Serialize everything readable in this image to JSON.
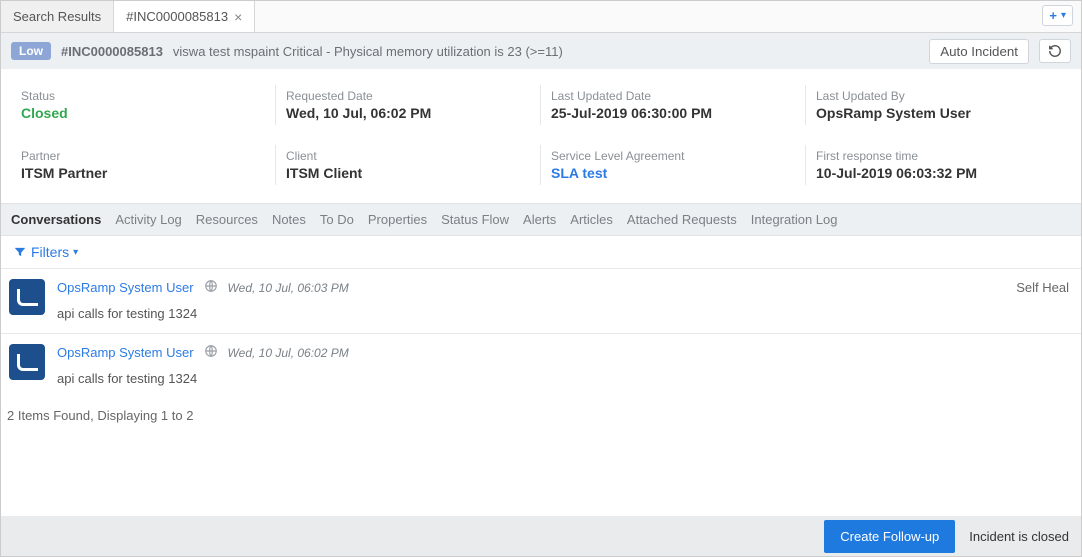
{
  "tabs": {
    "searchResults": "Search Results",
    "active": "#INC0000085813"
  },
  "header": {
    "priority": "Low",
    "id": "#INC0000085813",
    "title": "viswa test mspaint Critical - Physical memory utilization is 23 (>=11)",
    "autoIncident": "Auto Incident"
  },
  "details": {
    "statusLabel": "Status",
    "statusValue": "Closed",
    "requestedLabel": "Requested Date",
    "requestedValue": "Wed, 10 Jul, 06:02 PM",
    "updatedLabel": "Last Updated Date",
    "updatedValue": "25-Jul-2019 06:30:00 PM",
    "updatedByLabel": "Last Updated By",
    "updatedByValue": "OpsRamp System User",
    "partnerLabel": "Partner",
    "partnerValue": "ITSM Partner",
    "clientLabel": "Client",
    "clientValue": "ITSM Client",
    "slaLabel": "Service Level Agreement",
    "slaValue": "SLA test",
    "firstRespLabel": "First response time",
    "firstRespValue": "10-Jul-2019 06:03:32 PM"
  },
  "subtabs": {
    "conversations": "Conversations",
    "activityLog": "Activity Log",
    "resources": "Resources",
    "notes": "Notes",
    "todo": "To Do",
    "properties": "Properties",
    "statusFlow": "Status Flow",
    "alerts": "Alerts",
    "articles": "Articles",
    "attached": "Attached Requests",
    "integration": "Integration Log"
  },
  "filtersLabel": "Filters",
  "conversations": [
    {
      "user": "OpsRamp System User",
      "time": "Wed, 10 Jul, 06:03 PM",
      "tag": "Self Heal",
      "body": "api calls for testing 1324"
    },
    {
      "user": "OpsRamp System User",
      "time": "Wed, 10 Jul, 06:02 PM",
      "tag": "",
      "body": "api calls for testing 1324"
    }
  ],
  "paging": "2 Items Found, Displaying  1 to 2",
  "footer": {
    "createFollowUp": "Create Follow-up",
    "closedText": "Incident is closed"
  }
}
